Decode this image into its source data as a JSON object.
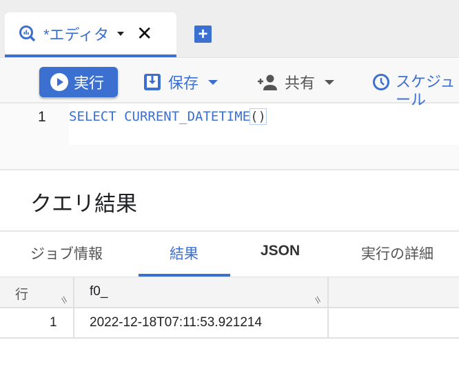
{
  "tab": {
    "title": "*エディタ",
    "icon": "bigquery-search-icon",
    "close": "✕",
    "new_tab": "+"
  },
  "toolbar": {
    "run": "実行",
    "save": "保存",
    "share": "共有",
    "schedule": "スケジュール"
  },
  "editor": {
    "line": "1",
    "code_prefix": "SELECT CURRENT_DATETIME",
    "code_parens": "()"
  },
  "results": {
    "title": "クエリ結果",
    "tabs": [
      "ジョブ情報",
      "結果",
      "JSON",
      "実行の詳細"
    ],
    "active_tab": "結果"
  },
  "table": {
    "headers": [
      "行",
      "f0_"
    ],
    "rows": [
      {
        "row": "1",
        "f0_": "2022-12-18T07:11:53.921214"
      }
    ]
  },
  "colors": {
    "accent": "#3b6fd0"
  }
}
